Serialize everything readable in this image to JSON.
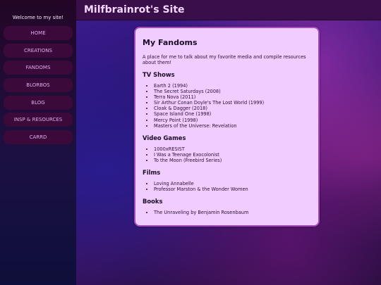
{
  "header": {
    "title": "Milfbrainrot's Site"
  },
  "sidebar": {
    "welcome": "Welcome to my site!",
    "items": [
      {
        "label": "HOME"
      },
      {
        "label": "CREATIONS"
      },
      {
        "label": "FANDOMS"
      },
      {
        "label": "BLORBOS"
      },
      {
        "label": "BLOG"
      },
      {
        "label": "INSP & RESOURCES"
      },
      {
        "label": "CARRD"
      }
    ]
  },
  "main": {
    "title": "My Fandoms",
    "intro": "A place for me to talk about my favorite media and compile resources about them!",
    "sections": [
      {
        "heading": "TV Shows",
        "items": [
          "Earth 2 (1994)",
          "The Secret Saturdays (2008)",
          "Terra Nova (2011)",
          "Sir Arthur Conan Doyle's The Lost World (1999)",
          "Cloak & Dagger (2018)",
          "Space Island One (1998)",
          "Mercy Point (1998)",
          "Masters of the Universe: Revelation"
        ]
      },
      {
        "heading": "Video Games",
        "items": [
          "1000xRESIST",
          "I Was a Teenage Exocolonist",
          "To the Moon (Freebird Series)"
        ]
      },
      {
        "heading": "Films",
        "items": [
          "Loving Annabelle",
          "Professor Marston & the Wonder Women"
        ]
      },
      {
        "heading": "Books",
        "items": [
          "The Unraveling by Benjamin Rosenbaum"
        ]
      }
    ]
  },
  "colors": {
    "sidebar_button": "#3c0a3a",
    "sidebar_text": "#e2a9ee",
    "card_bg": "#f0ccff",
    "card_border": "#a24bb8",
    "title_text": "#f4d7ff"
  }
}
